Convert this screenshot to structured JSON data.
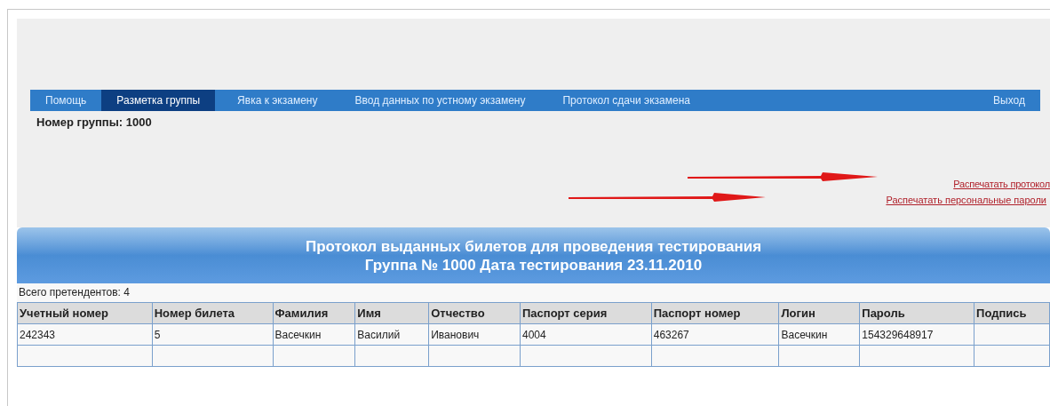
{
  "nav": {
    "tabs": [
      {
        "label": "Помощь",
        "selected": false
      },
      {
        "label": "Разметка группы",
        "selected": true
      },
      {
        "label": "Явка к экзамену",
        "selected": false
      },
      {
        "label": "Ввод данных по устному экзамену",
        "selected": false
      },
      {
        "label": "Протокол сдачи экзамена",
        "selected": false
      },
      {
        "label": "Выход",
        "selected": false
      }
    ]
  },
  "group_number": "Номер группы: 1000",
  "print_links": [
    "Распечатать протокол",
    "Распечатать персональные пароли"
  ],
  "table": {
    "title_lines": [
      "Протокол выданных билетов для проведения тестирования",
      "Группа № 1000 Дата тестирования 23.11.2010"
    ],
    "total": "Всего претендентов: 4",
    "columns": [
      "Учетный номер",
      "Номер билета",
      "Фамилия",
      "Имя",
      "Отчество",
      "Паспорт серия",
      "Паспорт номер",
      "Логин",
      "Пароль",
      "Подпись"
    ],
    "rows": [
      [
        "242343",
        "5",
        "Васечкин",
        "Василий",
        "Иванович",
        "4004",
        "463267",
        "Васечкин",
        "154329648917",
        ""
      ]
    ]
  }
}
